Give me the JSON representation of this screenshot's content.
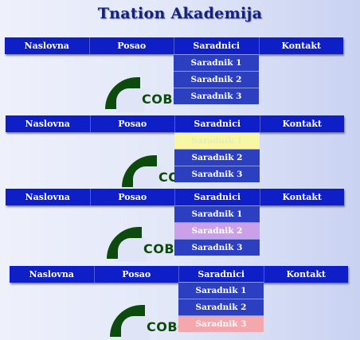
{
  "page": {
    "title": "Tnation Akademija"
  },
  "nav": {
    "items": [
      "Naslovna",
      "Posao",
      "Saradnici",
      "Kontakt"
    ]
  },
  "dropdown": {
    "items": [
      "Saradnik 1",
      "Saradnik 2",
      "Saradnik 3"
    ]
  },
  "logo": {
    "text": "COBOL"
  },
  "colors": {
    "navbar": "#0f1fc7",
    "dropdown": "#2b3fc0",
    "hover_state_2": "#f8f7a4",
    "hover_state_3": "#caa0e8",
    "hover_state_4": "#f4a7ad"
  }
}
